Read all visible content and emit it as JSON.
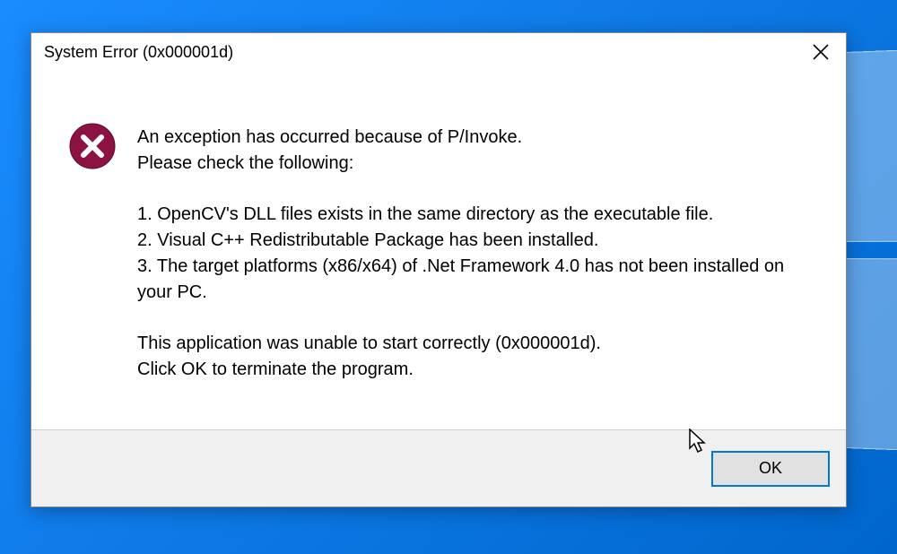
{
  "dialog": {
    "title": "System Error (0x000001d)",
    "lines": {
      "a": "An exception has occurred because of P/Invoke.",
      "b": "Please check the following:",
      "c": "1. OpenCV's DLL files exists in the same directory as the executable file.",
      "d": "2. Visual C++ Redistributable Package has been installed.",
      "e": "3. The target platforms (x86/x64) of .Net Framework 4.0 has not been installed on your PC.",
      "f": "This application was unable to start correctly (0x000001d).",
      "g": "Click OK to terminate the program."
    },
    "ok_label": "OK"
  },
  "icons": {
    "error_fill": "#8c1341",
    "error_x": "#ffffff"
  }
}
